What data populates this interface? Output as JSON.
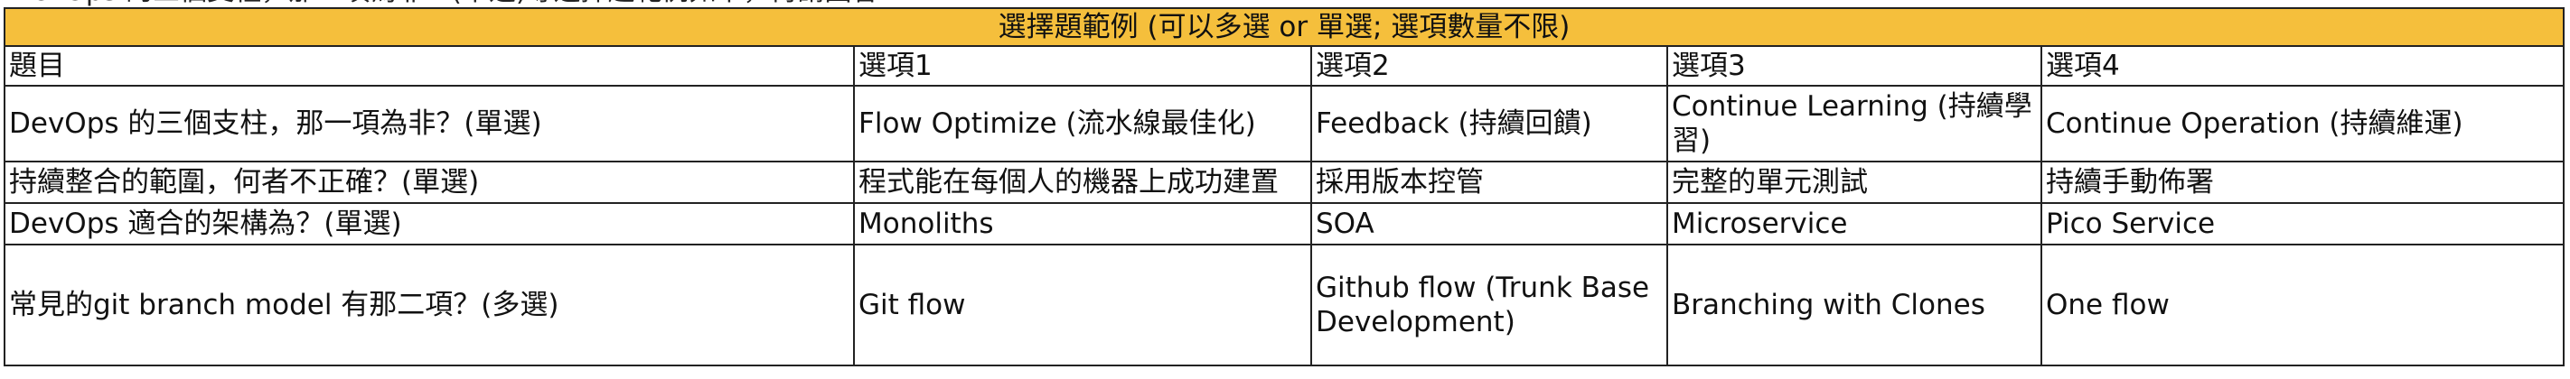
{
  "top_text": "DevOps 的三個支柱，那一項為非？(單選)等選擇題範例如下，再請回答",
  "table": {
    "title": "選擇題範例 (可以多選 or 單選; 選項數量不限)",
    "headers": [
      "題目",
      "選項1",
      "選項2",
      "選項3",
      "選項4"
    ],
    "rows": [
      [
        "DevOps 的三個支柱，那一項為非？(單選)",
        "Flow Optimize (流水線最佳化)",
        "Feedback (持續回饋)",
        "Continue Learning (持續學習)",
        "Continue Operation (持續維運)"
      ],
      [
        "持續整合的範圍，何者不正確？(單選)",
        "程式能在每個人的機器上成功建置",
        "採用版本控管",
        "完整的單元測試",
        "持續手動佈署"
      ],
      [
        "DevOps 適合的架構為？(單選)",
        "Monoliths",
        "SOA",
        "Microservice",
        "Pico Service"
      ],
      [
        "常見的git branch model 有那二項？(多選)",
        "Git flow",
        "Github flow (Trunk Base Development)",
        "Branching with Clones",
        "One flow"
      ]
    ]
  },
  "colors": {
    "title_bg": "#f5bf3c",
    "border": "#222222"
  }
}
